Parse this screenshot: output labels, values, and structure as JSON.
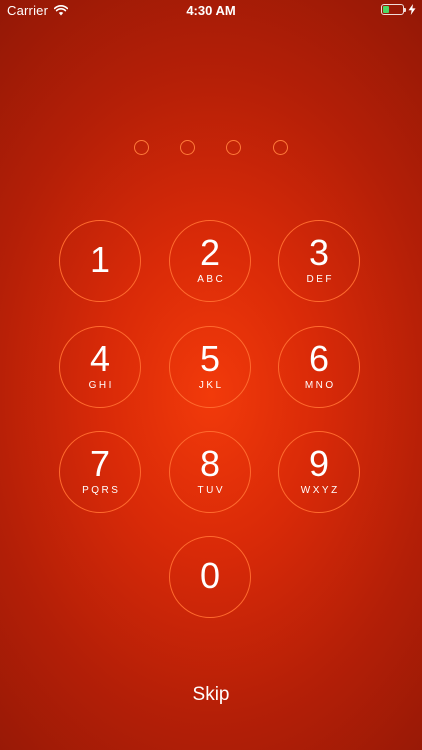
{
  "status_bar": {
    "carrier": "Carrier",
    "time": "4:30 AM",
    "battery_level": 0.3,
    "battery_fill_color": "#4cd964",
    "wifi_icon": "wifi-icon",
    "charging_icon": "bolt-icon"
  },
  "passcode": {
    "length": 4,
    "entered": 0
  },
  "keypad": {
    "keys": [
      {
        "digit": "1",
        "letters": ""
      },
      {
        "digit": "2",
        "letters": "ABC"
      },
      {
        "digit": "3",
        "letters": "DEF"
      },
      {
        "digit": "4",
        "letters": "GHI"
      },
      {
        "digit": "5",
        "letters": "JKL"
      },
      {
        "digit": "6",
        "letters": "MNO"
      },
      {
        "digit": "7",
        "letters": "PQRS"
      },
      {
        "digit": "8",
        "letters": "TUV"
      },
      {
        "digit": "9",
        "letters": "WXYZ"
      },
      {
        "digit": "0",
        "letters": ""
      }
    ]
  },
  "skip_label": "Skip",
  "colors": {
    "background_center": "#f23a0a",
    "background_edge": "#8f1706",
    "ring": "#ff6a2e"
  }
}
